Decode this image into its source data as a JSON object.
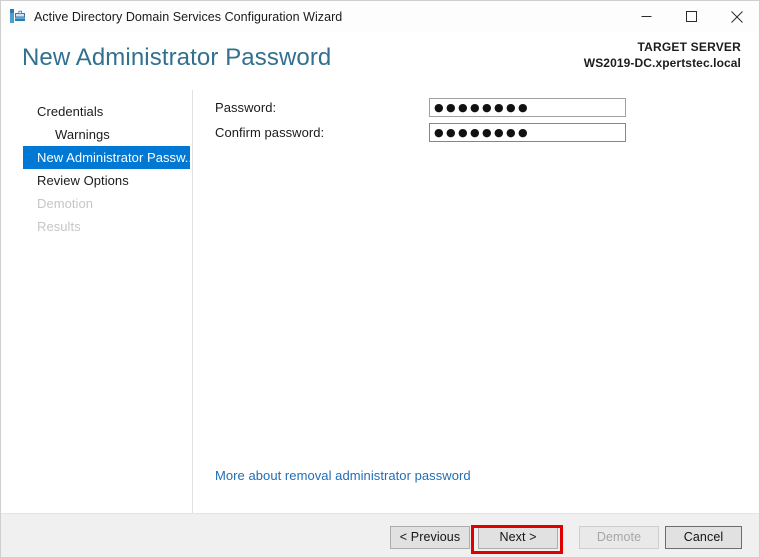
{
  "window": {
    "title": "Active Directory Domain Services Configuration Wizard",
    "icon": "ad-wizard-icon",
    "controls": {
      "minimize": "minimize-icon",
      "maximize": "maximize-icon",
      "close": "close-icon"
    }
  },
  "header": {
    "page_title": "New Administrator Password",
    "target_server_label": "TARGET SERVER",
    "target_server_value": "WS2019-DC.xpertstec.local"
  },
  "sidebar": {
    "items": [
      {
        "label": "Credentials",
        "state": "normal",
        "indent": false
      },
      {
        "label": "Warnings",
        "state": "normal",
        "indent": true
      },
      {
        "label": "New Administrator Passw...",
        "state": "selected",
        "indent": false
      },
      {
        "label": "Review Options",
        "state": "normal",
        "indent": false
      },
      {
        "label": "Demotion",
        "state": "disabled",
        "indent": false
      },
      {
        "label": "Results",
        "state": "disabled",
        "indent": false
      }
    ]
  },
  "form": {
    "password_label": "Password:",
    "password_value": "●●●●●●●●",
    "confirm_label": "Confirm password:",
    "confirm_value": "●●●●●●●●",
    "more_link": "More about removal administrator password"
  },
  "footer": {
    "previous": "< Previous",
    "next": "Next >",
    "demote": "Demote",
    "cancel": "Cancel"
  },
  "annotation": {
    "highlight_target": "Next >",
    "highlight_color": "#e00000"
  },
  "colors": {
    "accent": "#0078d4",
    "title_text": "#31708f",
    "link": "#1f6eb5",
    "footer_bg": "#f0f0f0"
  }
}
